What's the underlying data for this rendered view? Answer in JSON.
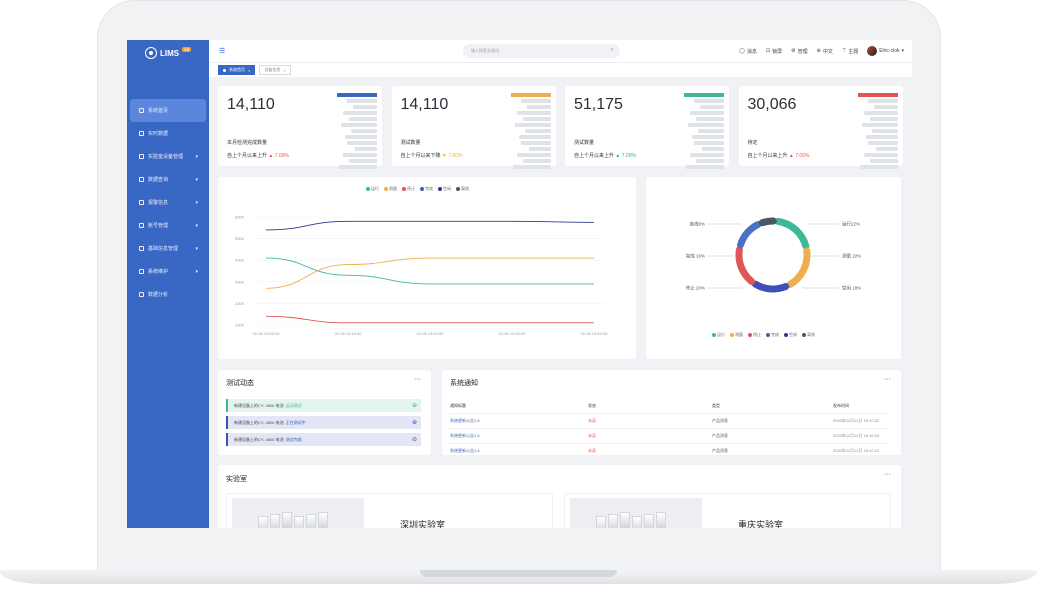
{
  "app": {
    "name": "LIMS",
    "version_badge": "V3"
  },
  "sidebar": {
    "items": [
      {
        "label": "系统首页",
        "has_caret": false
      },
      {
        "label": "实时数据",
        "has_caret": false
      },
      {
        "label": "实验室设备管理",
        "has_caret": true
      },
      {
        "label": "数据查询",
        "has_caret": true
      },
      {
        "label": "报警信息",
        "has_caret": true
      },
      {
        "label": "账号管理",
        "has_caret": true
      },
      {
        "label": "基础信息管理",
        "has_caret": true
      },
      {
        "label": "系统维护",
        "has_caret": true
      },
      {
        "label": "数据分析",
        "has_caret": false
      }
    ]
  },
  "topbar": {
    "search_placeholder": "输入搜索关键词",
    "tools": [
      {
        "icon": "message-icon",
        "label": "消息"
      },
      {
        "icon": "lock-icon",
        "label": "锁屏"
      },
      {
        "icon": "gear-icon",
        "label": "管理"
      },
      {
        "icon": "globe-icon",
        "label": "中文"
      },
      {
        "icon": "shirt-icon",
        "label": "主题"
      }
    ],
    "user": "Elric-clok"
  },
  "tabs": [
    {
      "label": "系统首页",
      "active": true
    },
    {
      "label": "设备信息",
      "active": false
    }
  ],
  "stats": [
    {
      "value": "14,110",
      "label": "本月检测完成数量",
      "compare": "自上个月以来上升",
      "trend": "up",
      "change": "7.00%",
      "accent": "#3967c4"
    },
    {
      "value": "14,110",
      "label": "测试数量",
      "compare": "自上个月以来下降",
      "trend": "down",
      "change": "7.00%",
      "accent": "#f0ad4e"
    },
    {
      "value": "51,175",
      "label": "测试数量",
      "compare": "自上个月以来上升",
      "trend": "up-green",
      "change": "7.00%",
      "accent": "#3fb89a"
    },
    {
      "value": "30,066",
      "label": "待定",
      "compare": "自上个月以来上升",
      "trend": "up",
      "change": "7.00%",
      "accent": "#e05555"
    }
  ],
  "line_chart": {
    "legend": [
      {
        "name": "运行",
        "color": "#3fb89a"
      },
      {
        "name": "测量",
        "color": "#f0ad4e"
      },
      {
        "name": "停止",
        "color": "#e05555"
      },
      {
        "name": "完成",
        "color": "#3d5fb8"
      },
      {
        "name": "空闲",
        "color": "#2d3a8c"
      },
      {
        "name": "离线",
        "color": "#4a5566"
      }
    ],
    "y_ticks": [
      "6000",
      "5000",
      "4000",
      "3000",
      "2000",
      "1000"
    ],
    "x_ticks": [
      "02-05 13:09:00",
      "02-05 13:10:00",
      "02-05 13:20:00",
      "02-05 13:30:00",
      "02-05 13:40:00"
    ]
  },
  "chart_data": {
    "type": "line",
    "x": [
      "02-05 13:09:00",
      "02-05 13:10:00",
      "02-05 13:20:00",
      "02-05 13:30:00",
      "02-05 13:40:00"
    ],
    "ylim": [
      1000,
      6000
    ],
    "series": [
      {
        "name": "运行",
        "values": [
          4100,
          3300,
          2900,
          2900,
          2900
        ]
      },
      {
        "name": "测量",
        "values": [
          2700,
          3800,
          4100,
          4100,
          4100
        ]
      },
      {
        "name": "停止",
        "values": [
          1400,
          1100,
          1100,
          1100,
          1100
        ]
      },
      {
        "name": "空闲",
        "values": [
          5400,
          5800,
          5800,
          5800,
          5750
        ]
      }
    ]
  },
  "donut": {
    "labels_left": [
      "离线8%",
      "完成 16%",
      "停止 20%"
    ],
    "labels_right": [
      "运行22%",
      "测量 22%",
      "空闲 18%"
    ],
    "legend": [
      {
        "name": "运行",
        "color": "#3fb89a"
      },
      {
        "name": "测量",
        "color": "#f0ad4e"
      },
      {
        "name": "停止",
        "color": "#e05555"
      },
      {
        "name": "完成",
        "color": "#3d5fb8"
      },
      {
        "name": "空闲",
        "color": "#2d3a8c"
      },
      {
        "name": "离线",
        "color": "#4a5566"
      }
    ],
    "segments": [
      {
        "name": "运行",
        "value": 22,
        "color": "#3fb89a"
      },
      {
        "name": "测量",
        "value": 22,
        "color": "#f0ad4e"
      },
      {
        "name": "空闲",
        "value": 18,
        "color": "#3d4fb8"
      },
      {
        "name": "停止",
        "value": 20,
        "color": "#e05555"
      },
      {
        "name": "完成",
        "value": 16,
        "color": "#4a70c8"
      },
      {
        "name": "离线",
        "value": 8,
        "color": "#4a5566"
      }
    ]
  },
  "activity": {
    "title": "测试动态",
    "items": [
      {
        "text": "新建设备上的CY- 4000 电池",
        "tag": "运动测试",
        "tag_color": "#3fb89a",
        "bg": "#e4f5ef",
        "border": "#3fb89a"
      },
      {
        "text": "新建设备上的CY- 4000 电池",
        "tag": "正在测试中",
        "tag_color": "#3d4fb8",
        "bg": "#e3e6f4",
        "border": "#3d4fb8"
      },
      {
        "text": "新建设备上的CY- 4000 电池",
        "tag": "测试完成",
        "tag_color": "#3d4fb8",
        "bg": "#e3e6f4",
        "border": "#3d4fb8"
      }
    ]
  },
  "notices": {
    "title": "系统通知",
    "headers": [
      "通知标题",
      "状态",
      "类型",
      "发布时间"
    ],
    "rows": [
      {
        "title": "系统更新公告1.5",
        "status": "未读",
        "type": "产品消息",
        "time": "2020年11月12日 15:10:32"
      },
      {
        "title": "系统更新公告1.5",
        "status": "未读",
        "type": "产品消息",
        "time": "2020年11月12日 15:10:10"
      },
      {
        "title": "系统更新公告1.4",
        "status": "未读",
        "type": "产品消息",
        "time": "2020年11月12日 15:10:12"
      }
    ]
  },
  "labs": {
    "title": "实验室",
    "items": [
      {
        "name": "深圳实验室"
      },
      {
        "name": "重庆实验室"
      }
    ]
  }
}
